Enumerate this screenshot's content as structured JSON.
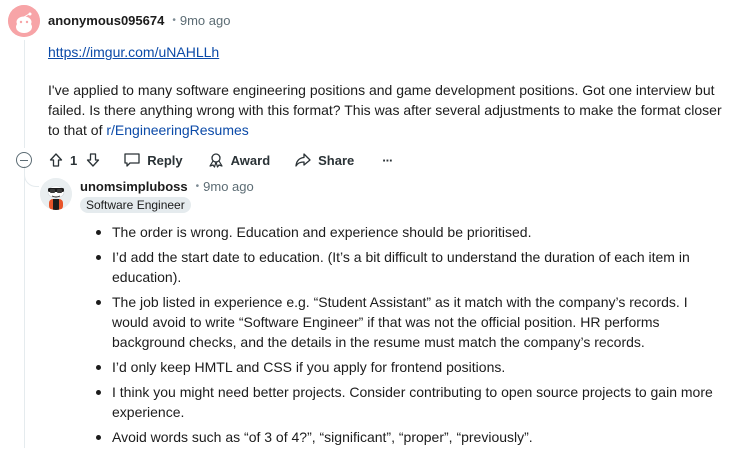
{
  "comment": {
    "author": "anonymous095674",
    "separator": "•",
    "time": "9mo ago",
    "link": "https://imgur.com/uNAHLLh",
    "body_text": "I've applied to many software engineering positions and game development positions. Got one interview but failed. Is there anything wrong with this format? This was after several adjustments to make the format closer to that of ",
    "subreddit_link": "r/EngineeringResumes",
    "votes": "1",
    "actions": {
      "reply": "Reply",
      "award": "Award",
      "share": "Share",
      "more": "···"
    }
  },
  "reply": {
    "author": "unomsimpluboss",
    "separator": "•",
    "time": "9mo ago",
    "flair": "Software Engineer",
    "bullets": [
      "The order is wrong. Education and experience should be prioritised.",
      "I’d add the start date to education. (It’s a bit difficult to understand the duration of each item in education).",
      "The job listed in experience e.g. “Student Assistant” as it match with the company’s records. I would avoid to write “Software Engineer” if that was not the official position. HR performs background checks, and the details in the resume must match the company’s records.",
      "I’d only keep HMTL and CSS if you apply for frontend positions.",
      "I think you might need better projects. Consider contributing to open source projects to gain more experience.",
      "Avoid words such as “of 3 of 4?”, “significant”, “proper”, “previously”."
    ]
  }
}
